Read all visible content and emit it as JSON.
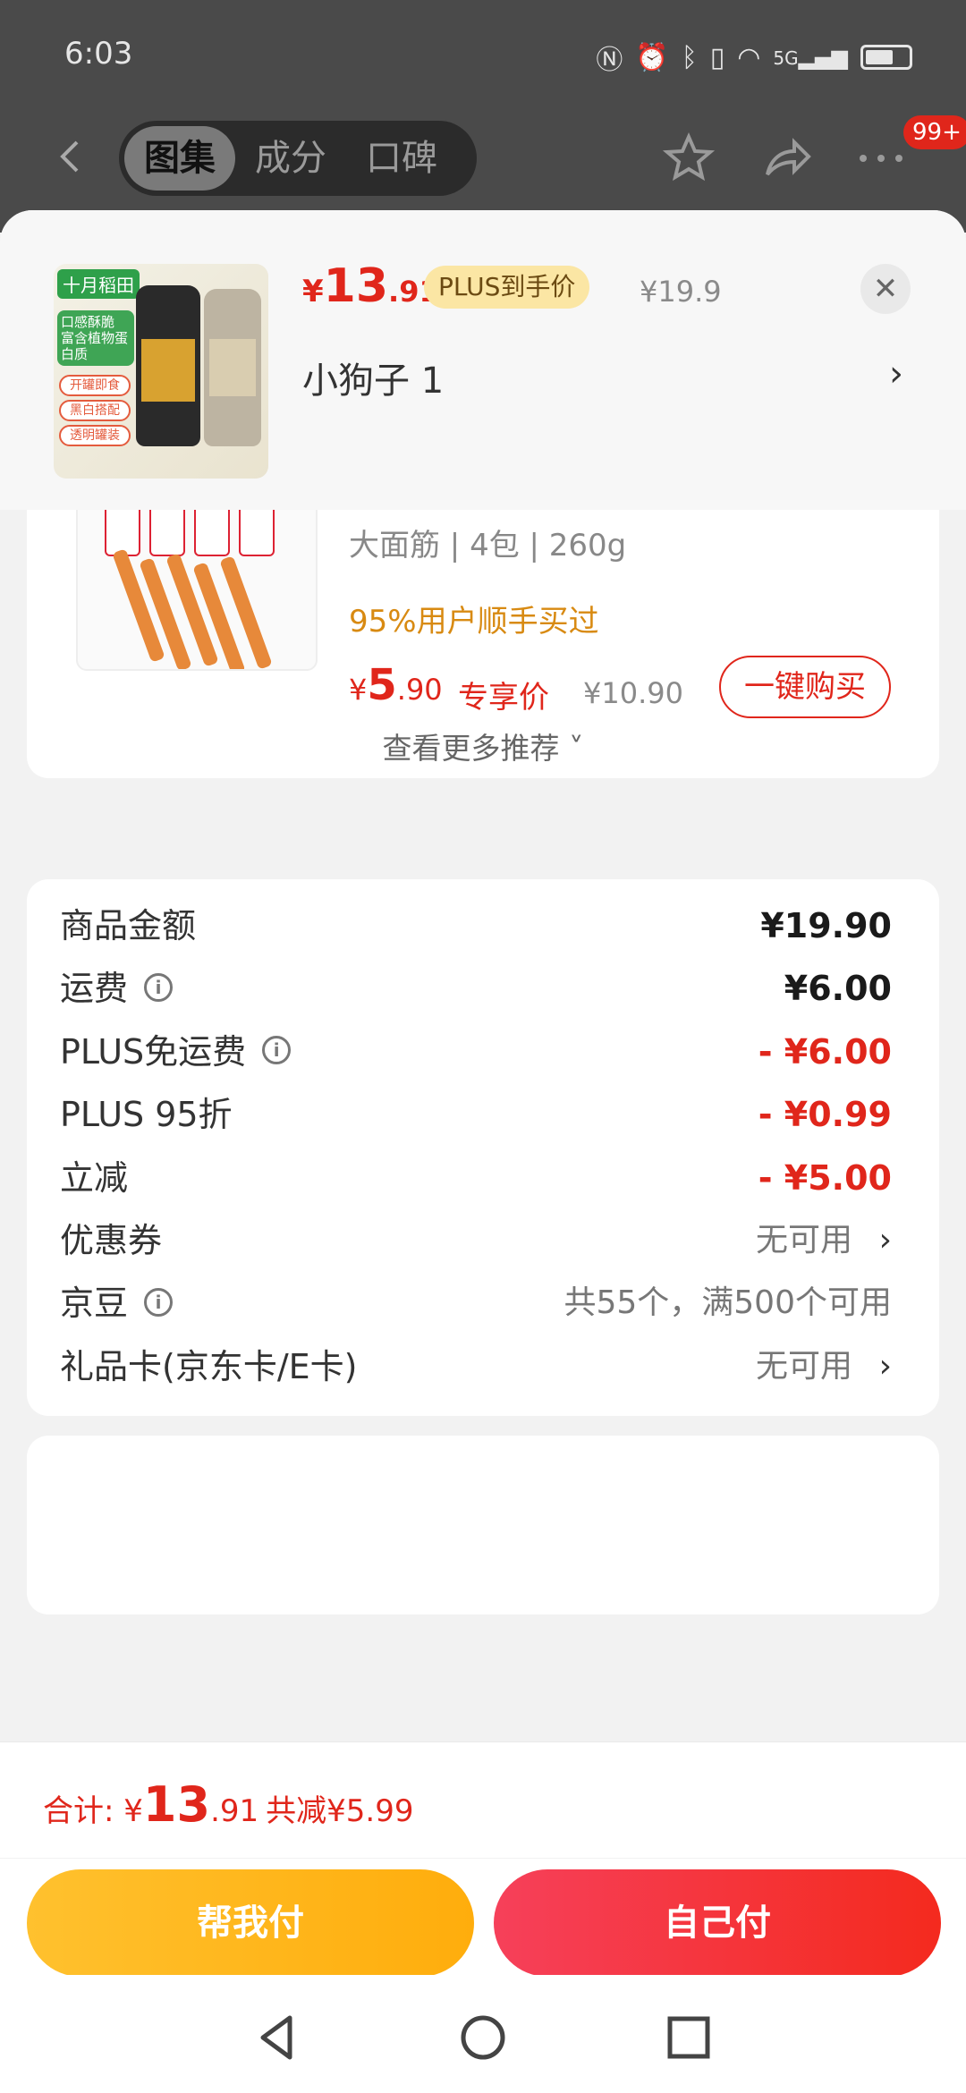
{
  "status": {
    "time": "6:03",
    "network": "5G"
  },
  "topnav": {
    "tabs": [
      {
        "label": "图集",
        "active": true
      },
      {
        "label": "成分",
        "active": false
      },
      {
        "label": "口碑",
        "active": false
      }
    ],
    "badge": "99+"
  },
  "sheet": {
    "product": {
      "brand": "十月稻田",
      "thumb_tag": "口感酥脆 富含植物蛋白质",
      "thumb_pills": [
        "开罐即食",
        "黑白搭配",
        "透明罐装"
      ],
      "price_symbol": "¥",
      "price_int": "13",
      "price_dec": ".91",
      "plus_label": "PLUS到手价",
      "original_price": "¥19.9",
      "variant": "小狗子  1"
    },
    "recommendation": {
      "spec": "大面筋 | 4包 | 260g",
      "bought": "95%用户顺手买过",
      "price_symbol": "¥",
      "price_int": "5",
      "price_dec": ".90",
      "exclusive": "专享价",
      "original_price": "¥10.90",
      "buy_label": "一键购买",
      "more_label": "查看更多推荐 ˅"
    },
    "summary": [
      {
        "label": "商品金额",
        "value": "¥19.90",
        "style": "normal",
        "info": false
      },
      {
        "label": "运费",
        "value": "¥6.00",
        "style": "normal",
        "info": true
      },
      {
        "label": "PLUS免运费",
        "value": "- ¥6.00",
        "style": "red",
        "info": true
      },
      {
        "label": "PLUS 95折",
        "value": "- ¥0.99",
        "style": "red",
        "info": false
      },
      {
        "label": "立减",
        "value": "- ¥5.00",
        "style": "red",
        "info": false
      },
      {
        "label": "优惠券",
        "value": "无可用",
        "style": "muted",
        "info": false
      },
      {
        "label": "京豆",
        "value": "共55个，满500个可用",
        "style": "muted",
        "info": true
      },
      {
        "label": "礼品卡(京东卡/E卡)",
        "value": "无可用",
        "style": "muted",
        "info": false
      }
    ]
  },
  "footer": {
    "total_label": "合计: ",
    "total_symbol": "¥",
    "total_int": "13",
    "total_dec": ".91",
    "saved": "共减¥5.99",
    "help_pay": "帮我付",
    "self_pay": "自己付"
  },
  "colors": {
    "accent": "#e0261b",
    "gold": "#ffb11a",
    "plus_bg": "#fbe6a4"
  }
}
